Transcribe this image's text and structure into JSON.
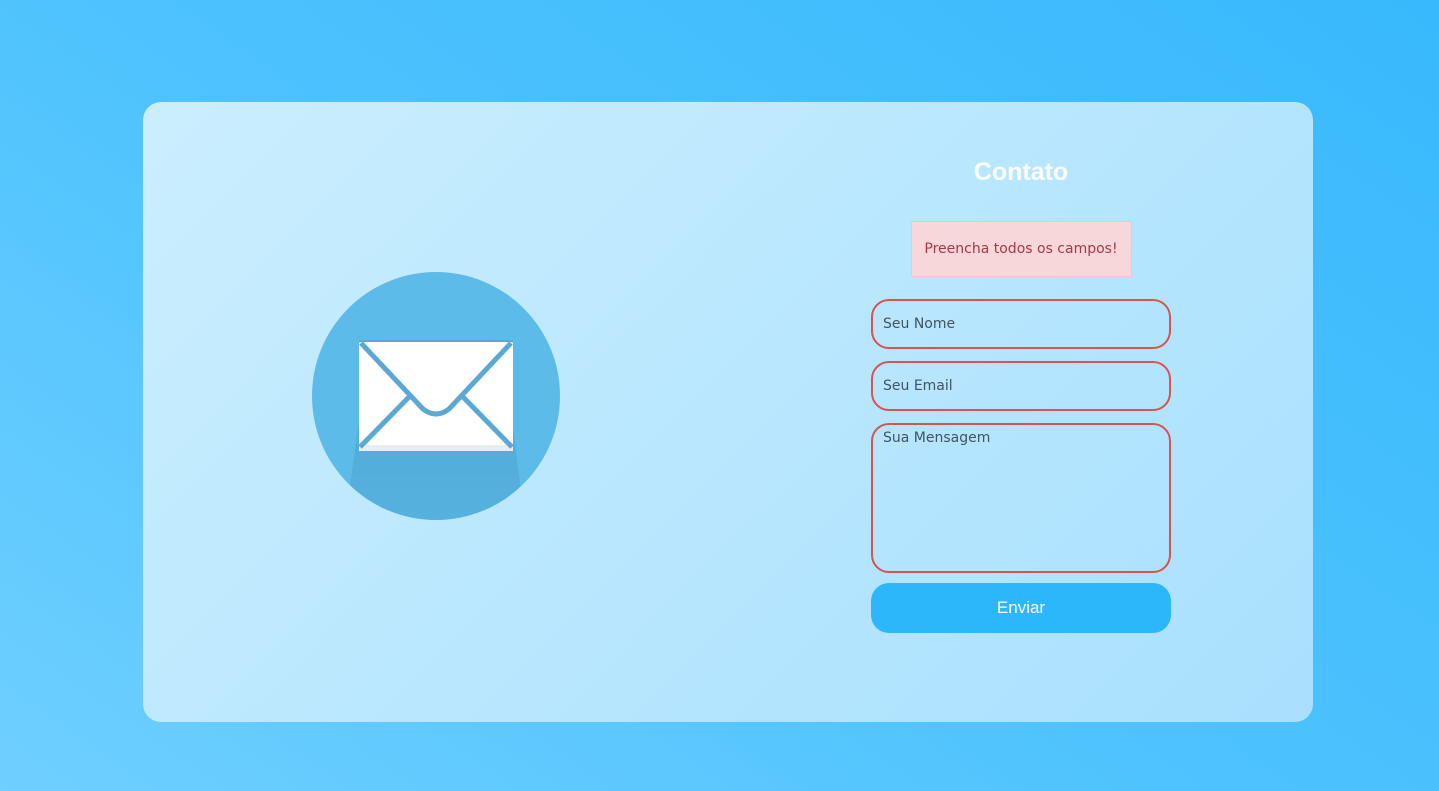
{
  "contact": {
    "title": "Contato",
    "alert_text": "Preencha todos os campos!",
    "name_placeholder": "Seu Nome",
    "email_placeholder": "Seu Email",
    "message_placeholder": "Sua Mensagem",
    "submit_label": "Enviar"
  },
  "illustration": {
    "icon": "envelope-icon"
  },
  "colors": {
    "page_background": "#4fc3fd",
    "card_background": "#bfe9fe",
    "circle": "#5dbbe9",
    "alert_background": "#f8d7da",
    "alert_text": "#a23a47",
    "field_border_error": "#d9534f",
    "button": "#2db7fb"
  }
}
